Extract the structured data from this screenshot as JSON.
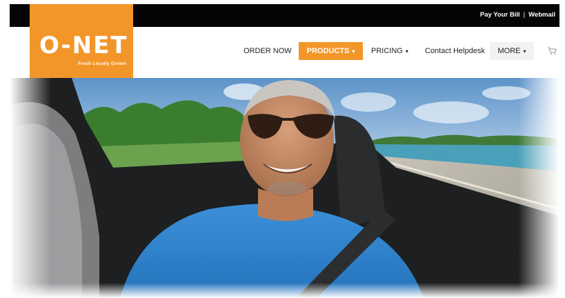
{
  "utility_nav": {
    "pay_bill": "Pay Your Bill",
    "separator": "|",
    "webmail": "Webmail"
  },
  "logo": {
    "brand": "O-NET",
    "tagline": "Fresh Locally Grown"
  },
  "nav": {
    "order_now": "ORDER NOW",
    "products": "PRODUCTS",
    "pricing": "PRICING",
    "contact": "Contact Helpdesk",
    "more": "MORE"
  },
  "icons": {
    "cart": "cart-icon",
    "caret": "chevron-down-icon"
  },
  "colors": {
    "brand_orange": "#f3962a",
    "topbar": "#050505"
  }
}
